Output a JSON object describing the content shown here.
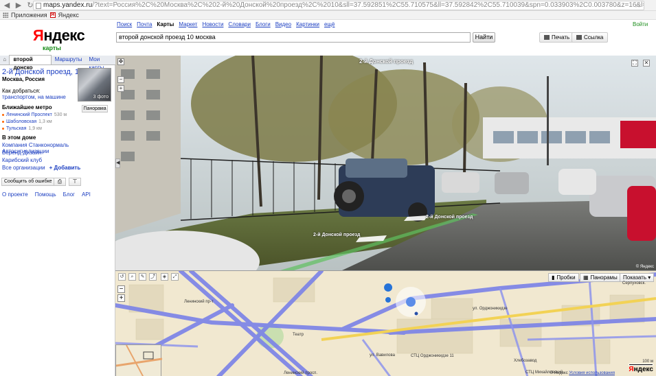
{
  "browser": {
    "url_host": "maps.yandex.ru",
    "url_rest": "/?text=Россия%2C%20Москва%2C%202-й%20Донской%20проезд%2C%2010&sll=37.592851%2C55.710575&ll=37.592842%2C55.710039&spn=0.033903%2C0.003780&z=16&l=map%2Cstv&ol=stv&oll=37.59434294%2",
    "bookmarks": [
      "Приложения",
      "Яндекс"
    ]
  },
  "header": {
    "logo": "Яндекс",
    "logo_first_letter": "Я",
    "logo_rest": "ндекс",
    "logo_sub": "карты",
    "services": [
      "Поиск",
      "Почта",
      "Карты",
      "Маркет",
      "Новости",
      "Словари",
      "Блоги",
      "Видео",
      "Картинки",
      "ещё"
    ],
    "active_service": "Карты",
    "search_value": "второй донской проезд 10 москва",
    "find_label": "Найти",
    "print_label": "Печать",
    "link_label": "Ссылка",
    "login_label": "Войти"
  },
  "left_panel": {
    "tabs": [
      "второй донско",
      "Маршруты",
      "Мои карты"
    ],
    "place_title": "2-й Донской проезд, 10",
    "place_sub": "Москва, Россия",
    "photo_count": "3 фото",
    "panorama_button": "Панорама",
    "how_label": "Как добраться:",
    "how_link": "транспортом, на машине",
    "metro_title": "Ближайшее метро",
    "metro": [
      {
        "name": "Ленинский Проспект",
        "dist": "530 м"
      },
      {
        "name": "Шаболовская",
        "dist": "1,3 км"
      },
      {
        "name": "Тульская",
        "dist": "1,9 км"
      }
    ],
    "house_title": "В этом доме",
    "orgs": [
      "Компания Станконормаль Автосигнализации",
      "Веренд-Дизайн",
      "Карибский клуб"
    ],
    "all_orgs": "Все организации",
    "add_label": "+ Добавить",
    "report_label": "Сообщить об ошибке",
    "footer": [
      "О проекте",
      "Помощь",
      "Блог",
      "API"
    ]
  },
  "panorama": {
    "title": "2-й Донской проезд",
    "road_label_1": "2-й Донской проезд",
    "road_label_2": "2-й Донской проезд",
    "copyright": "© Яндекс"
  },
  "map": {
    "buttons": {
      "traffic": "Пробки",
      "panoramas": "Панорамы",
      "show": "Показать ▾"
    },
    "labels": {
      "leninsky": "Ленинский пр-т",
      "ordzh": "ул. Орджоникидзе",
      "vavilova": "ул. Вавилова",
      "stc": "СТЦ Орджоникидзе 11",
      "theatre": "Театр",
      "khlebozavod": "Хлебозавод",
      "serpukhov": "Серпуховск.",
      "mikhailovsky": "СТЦ Михайловский",
      "leninsky_south": "Ленинский просп."
    },
    "scale": "100 м",
    "logo_first_letter": "Я",
    "logo_rest": "ндекс",
    "copyright": "© Яндекс",
    "terms": "Условия использования"
  },
  "colors": {
    "yandex_red": "#ff0000",
    "link_blue": "#1a3dc1",
    "green": "#1a8c1a",
    "road_blue": "#7a82e8",
    "map_bg": "#f1e8d0"
  }
}
